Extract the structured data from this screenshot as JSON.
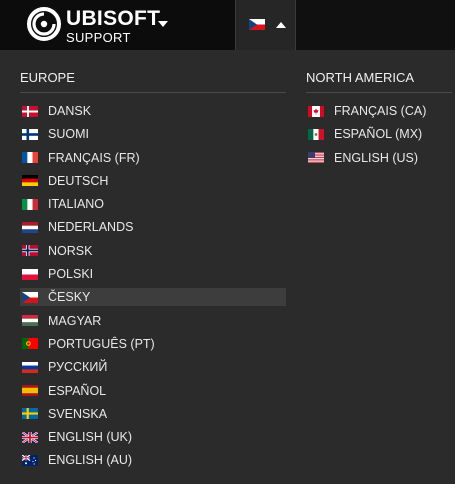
{
  "header": {
    "brand_name": "UBISOFT",
    "brand_sub": "SUPPORT",
    "brand_icon": "ubisoft-swirl-icon",
    "current_language_flag": "cz"
  },
  "regions": {
    "europe": {
      "title": "EUROPE",
      "languages": [
        {
          "label": "DANSK",
          "flag": "dk"
        },
        {
          "label": "SUOMI",
          "flag": "fi"
        },
        {
          "label": "FRANÇAIS (FR)",
          "flag": "fr"
        },
        {
          "label": "DEUTSCH",
          "flag": "de"
        },
        {
          "label": "ITALIANO",
          "flag": "it"
        },
        {
          "label": "NEDERLANDS",
          "flag": "nl"
        },
        {
          "label": "NORSK",
          "flag": "no"
        },
        {
          "label": "POLSKI",
          "flag": "pl"
        },
        {
          "label": "ČESKY",
          "flag": "cz",
          "selected": true
        },
        {
          "label": "MAGYAR",
          "flag": "hu"
        },
        {
          "label": "PORTUGUÊS (PT)",
          "flag": "pt"
        },
        {
          "label": "РУССКИЙ",
          "flag": "ru"
        },
        {
          "label": "ESPAÑOL",
          "flag": "es"
        },
        {
          "label": "SVENSKA",
          "flag": "se"
        },
        {
          "label": "ENGLISH (UK)",
          "flag": "gb"
        },
        {
          "label": "ENGLISH (AU)",
          "flag": "au"
        }
      ]
    },
    "north_america": {
      "title": "NORTH AMERICA",
      "languages": [
        {
          "label": "FRANÇAIS (CA)",
          "flag": "ca"
        },
        {
          "label": "ESPAÑOL (MX)",
          "flag": "mx"
        },
        {
          "label": "ENGLISH (US)",
          "flag": "us"
        }
      ]
    }
  },
  "colors": {
    "background": "#2b2b2b",
    "header": "#101010",
    "selected_row": "#3d3d3d"
  }
}
